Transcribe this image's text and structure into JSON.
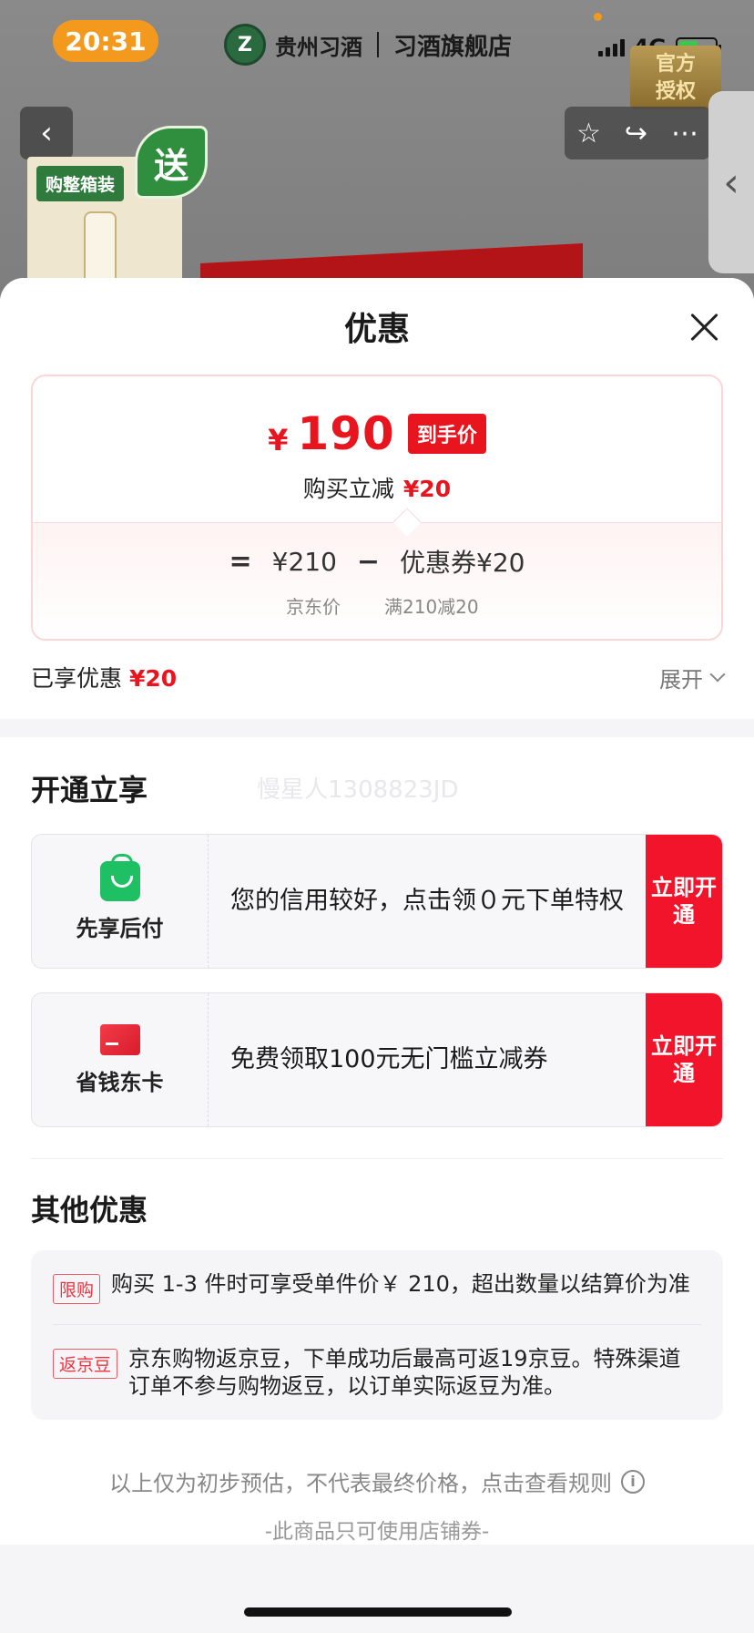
{
  "status": {
    "time": "20:31",
    "network": "4G"
  },
  "store": {
    "logo_mark": "Z",
    "brand": "贵州习酒",
    "name": "习酒旗舰店"
  },
  "background": {
    "promo_label": "购整箱装",
    "promo_badge": "送",
    "auth_badge_line1": "官方",
    "auth_badge_line2": "授权"
  },
  "sheet": {
    "title": "优惠",
    "price": {
      "currency": "¥",
      "final_price": "190",
      "final_tag": "到手价",
      "reduce_text": "购买立减",
      "reduce_amount": "¥20",
      "equals": "=",
      "original_price": "¥210",
      "minus": "−",
      "coupon_label": "优惠券¥20",
      "original_caption": "京东价",
      "coupon_caption": "满210减20"
    },
    "enjoyed": {
      "label": "已享优惠",
      "amount": "¥20",
      "expand": "展开"
    },
    "open_section": {
      "title": "开通立享",
      "watermark": "慢星人1308823JD",
      "cards": [
        {
          "name": "先享后付",
          "desc": "您的信用较好，点击领０元下单特权",
          "button": "立即开通"
        },
        {
          "name": "省钱东卡",
          "desc": "免费领取100元无门槛立减券",
          "button": "立即开通"
        }
      ]
    },
    "other_section": {
      "title": "其他优惠",
      "items": [
        {
          "tag": "限购",
          "text": "购买 1-3 件时可享受单件价￥ 210，超出数量以结算价为准"
        },
        {
          "tag": "返京豆",
          "text": "京东购物返京豆，下单成功后最高可返19京豆。特殊渠道订单不参与购物返豆，以订单实际返豆为准。"
        }
      ]
    },
    "footer": {
      "note": "以上仅为初步预估，不代表最终价格，点击查看规则",
      "sub": "-此商品只可使用店铺券-"
    }
  },
  "colors": {
    "accent_red": "#e8151f",
    "time_pill": "#f39a1e",
    "green": "#1fc064"
  }
}
